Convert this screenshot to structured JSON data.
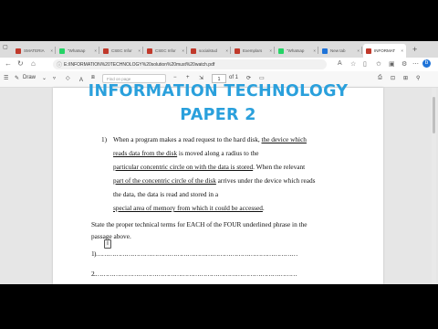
{
  "browser": {
    "tabs": [
      {
        "label": "SMATERIA",
        "color": "#c0392b"
      },
      {
        "label": "\"Whatsap",
        "color": "#25d366"
      },
      {
        "label": "CSEC Infor",
        "color": "#c0392b"
      },
      {
        "label": "CSEC Infor",
        "color": "#c0392b"
      },
      {
        "label": "socialstud",
        "color": "#c0392b"
      },
      {
        "label": "Exemplars",
        "color": "#c0392b"
      },
      {
        "label": "\"Whatsap",
        "color": "#25d366"
      },
      {
        "label": "New tab",
        "color": "#1e73d8"
      },
      {
        "label": "INFORMAT",
        "color": "#c0392b"
      }
    ],
    "url": "E:/INFORMATION%20TECHNOLOGY%20solution%20must%20watch.pdf",
    "profile_initial": "b"
  },
  "pdf_toolbar": {
    "draw_label": "Draw",
    "search_placeholder": "Find on page",
    "page_number": "1",
    "page_total": "of 1"
  },
  "document": {
    "title_line1": "INFORMATION TECHNOLOGY",
    "title_line2": "PAPER 2",
    "q_number": "1)",
    "line1_a": "When a program makes a read request to the hard disk,",
    "line1_b": "the device which",
    "line2_a": "reads data from the disk",
    "line2_b": " is moved along a radius to the",
    "line3_a": "particular concentric circle on with the data is stored",
    "line3_b": ". When the relevant",
    "line4_a": "part of the concentric circle of the disk",
    "line4_b": " arrives under the device which reads",
    "line5": "the data, the data is read and stored in a",
    "line6_a": "special area of memory from which it could be accessed",
    "line6_b": ".",
    "instr1": "State the proper technical terms for EACH of the FOUR underlined phrase in the",
    "instr2": "passage above.",
    "ans1": "1)………………………………………………………………………………………",
    "ans2": "2.………………………………………………………………………………………"
  },
  "colors": {
    "title_blue": "#2aa0dc",
    "browser_accent": "#1e73d8"
  }
}
